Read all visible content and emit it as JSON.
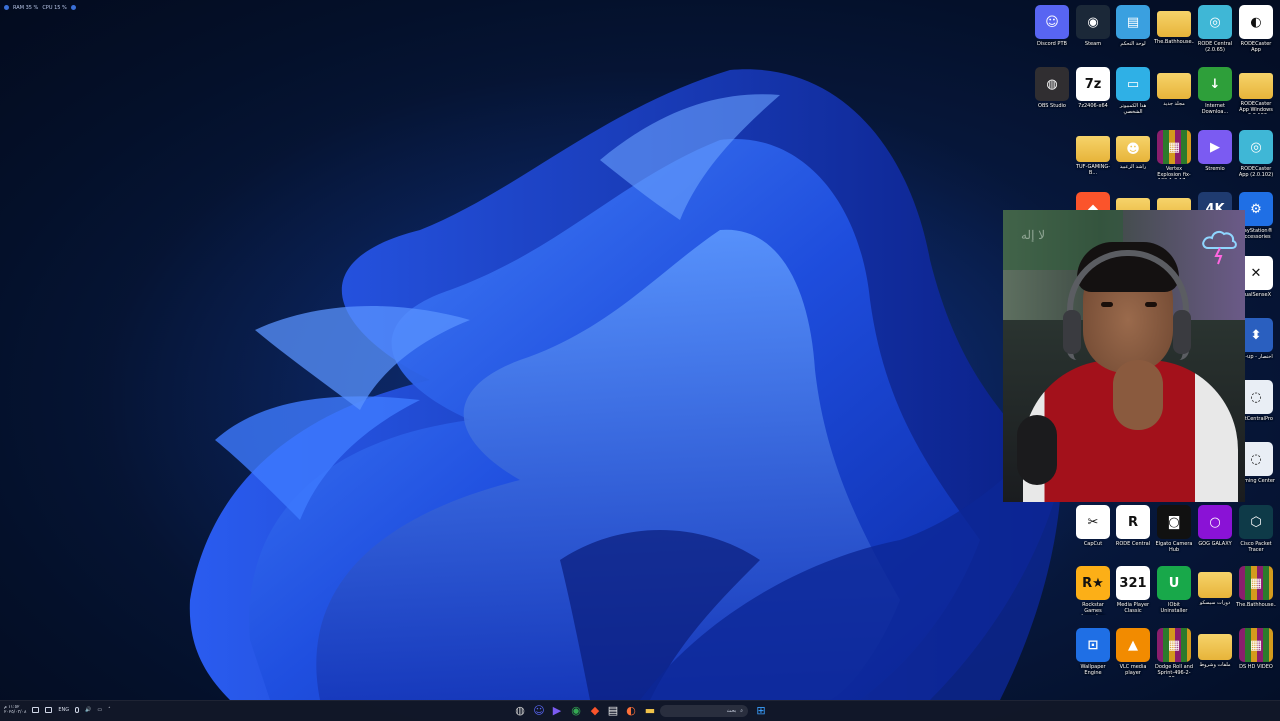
{
  "system_monitor": {
    "ram": "RAM 35 %",
    "cpu": "CPU 15 %"
  },
  "desktop_icons": [
    {
      "label": "Discord PTB",
      "icon": "discord-icon",
      "color": "#5865f2"
    },
    {
      "label": "Steam",
      "icon": "steam-icon",
      "color": "#1b2838"
    },
    {
      "label": "لوحة التحكم",
      "icon": "control-panel-icon",
      "color": "#3aa0e0"
    },
    {
      "label": "The.Bathhouse...",
      "icon": "folder-icon",
      "color": "#f0c24a"
    },
    {
      "label": "RODE Central (2.0.65)",
      "icon": "installer-disc-icon",
      "color": "#3fb7d6"
    },
    {
      "label": "RODECaster App",
      "icon": "rodecaster-icon",
      "color": "#ffffff"
    },
    {
      "label": "OBS Studio",
      "icon": "obs-icon",
      "color": "#302e31"
    },
    {
      "label": "7z2406-x64",
      "icon": "7zip-icon",
      "color": "#ffffff"
    },
    {
      "label": "هذا الكمبيوتر الشخصي",
      "icon": "this-pc-icon",
      "color": "#2fb0e6"
    },
    {
      "label": "مجلد جديد",
      "icon": "folder-icon",
      "color": "#f0c24a"
    },
    {
      "label": "Internet Downloa...",
      "icon": "idm-icon",
      "color": "#2e9f3a"
    },
    {
      "label": "RODECaster App Windows v2.0.102",
      "icon": "folder-icon",
      "color": "#f0c24a"
    },
    {
      "label": "TUF-GAMING-B...",
      "icon": "folder-icon",
      "color": "#f0c24a"
    },
    {
      "label": "راشد الزعبيد",
      "icon": "user-folder-icon",
      "color": "#f0c24a"
    },
    {
      "label": "Vertex Explosion fix-109-1-0-17...",
      "icon": "winrar-archive-icon",
      "color": "#8a1e6c"
    },
    {
      "label": "Stremio",
      "icon": "stremio-icon",
      "color": "#7b5bf2"
    },
    {
      "label": "RODECaster App (2.0.102)",
      "icon": "installer-disc-icon",
      "color": "#3fb7d6"
    },
    {
      "label": "",
      "icon": "brave-icon",
      "color": "#fb542b"
    },
    {
      "label": "",
      "icon": "folder-icon",
      "color": "#f0c24a"
    },
    {
      "label": "",
      "icon": "folder-icon",
      "color": "#f0c24a"
    },
    {
      "label": "",
      "icon": "4k-downloader-icon",
      "color": "#1f3b70"
    },
    {
      "label": "PlayStation® Accessories",
      "icon": "playstation-accessories-icon",
      "color": "#1f6fe5"
    },
    {
      "label": "DualSenseX",
      "icon": "dualsensex-icon",
      "color": "#ffffff"
    },
    {
      "label": "v2-up - اختصار",
      "icon": "shortcut-icon",
      "color": "#2a5fbf"
    },
    {
      "label": "ostCentralPro",
      "icon": "aimsoft-icon",
      "color": "#e9eef5"
    },
    {
      "label": "Gaming Center",
      "icon": "aimsoft-icon",
      "color": "#e9eef5"
    },
    {
      "label": "CapCut",
      "icon": "capcut-icon",
      "color": "#ffffff"
    },
    {
      "label": "RODE Central",
      "icon": "rode-central-icon",
      "color": "#ffffff"
    },
    {
      "label": "Elgato Camera Hub",
      "icon": "elgato-camera-icon",
      "color": "#111111"
    },
    {
      "label": "GOG GALAXY",
      "icon": "gog-galaxy-icon",
      "color": "#8a12d6"
    },
    {
      "label": "Cisco Packet Tracer",
      "icon": "packet-tracer-icon",
      "color": "#0e3a48"
    },
    {
      "label": "Rockstar Games Launcher",
      "icon": "rockstar-icon",
      "color": "#fcaf17"
    },
    {
      "label": "Media Player Classic",
      "icon": "mpc-icon",
      "color": "#ffffff"
    },
    {
      "label": "IObit Uninstaller",
      "icon": "iobit-uninstaller-icon",
      "color": "#18a84a"
    },
    {
      "label": "دورات سيسكو",
      "icon": "folder-icon",
      "color": "#f0c24a"
    },
    {
      "label": "The.Bathhouse...",
      "icon": "winrar-archive-icon",
      "color": "#8a1e6c"
    },
    {
      "label": "Wallpaper Engine",
      "icon": "wallpaper-engine-icon",
      "color": "#1f6fe5"
    },
    {
      "label": "VLC media player",
      "icon": "vlc-icon",
      "color": "#f28b00"
    },
    {
      "label": "Dodge Roll and Sprint-496-2-30...",
      "icon": "winrar-archive-icon",
      "color": "#8a1e6c"
    },
    {
      "label": "ملفات وشروط",
      "icon": "folder-icon",
      "color": "#f0c24a"
    },
    {
      "label": "DS HD VIDEO",
      "icon": "winrar-archive-icon",
      "color": "#8a1e6c"
    }
  ],
  "taskbar": {
    "clock_time": "١١:٥٢ م",
    "clock_date": "٢٠٢٥/٠٣/٠٨",
    "language": "ENG",
    "search_placeholder": "بحث",
    "pinned": [
      {
        "icon": "obs-icon",
        "color": "#cccccc"
      },
      {
        "icon": "discord-icon",
        "color": "#5865f2"
      },
      {
        "icon": "stremio-icon",
        "color": "#7b5bf2"
      },
      {
        "icon": "chrome-icon",
        "color": "#34a853"
      },
      {
        "icon": "brave-icon",
        "color": "#fb542b"
      },
      {
        "icon": "notes-icon",
        "color": "#eeeeee"
      },
      {
        "icon": "firefox-icon",
        "color": "#ff7139"
      },
      {
        "icon": "file-explorer-icon",
        "color": "#f0c24a"
      },
      {
        "icon": "start-icon",
        "color": "#3aa0ff"
      }
    ]
  }
}
